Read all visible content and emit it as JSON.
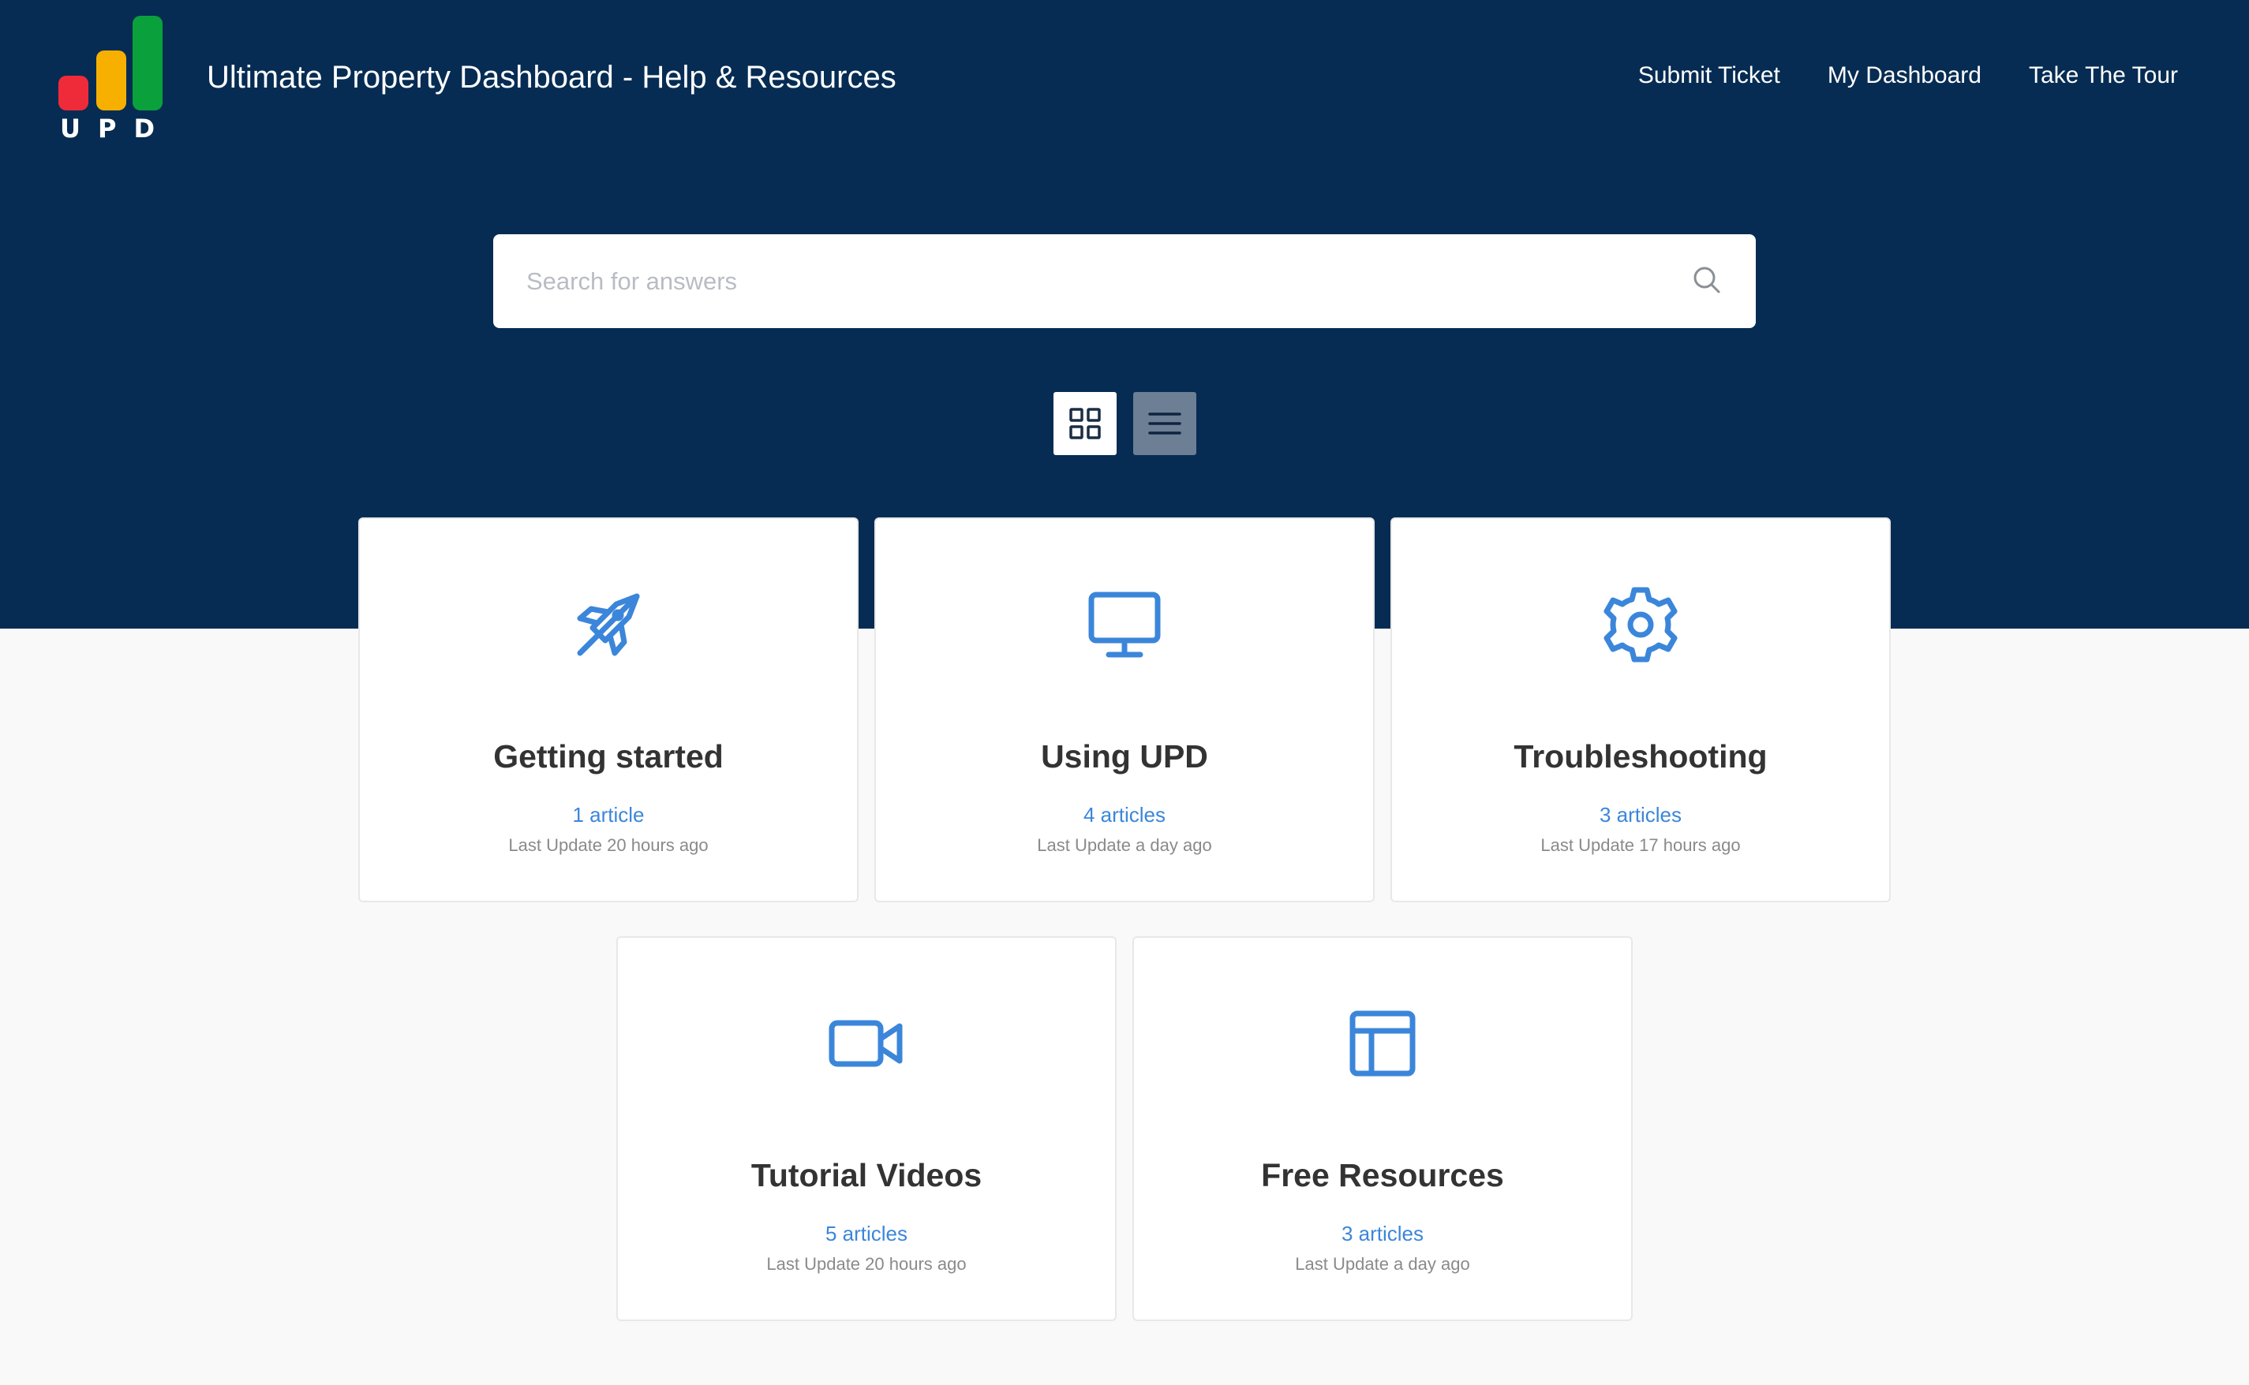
{
  "header": {
    "logo_text": "UPD",
    "site_title": "Ultimate Property Dashboard - Help & Resources",
    "nav": [
      "Submit Ticket",
      "My Dashboard",
      "Take The Tour"
    ]
  },
  "search": {
    "placeholder": "Search for answers"
  },
  "view_toggle": {
    "options": [
      "grid-icon",
      "list-icon"
    ],
    "active": "grid"
  },
  "colors": {
    "hero_bg": "#062c53",
    "accent": "#3b86da",
    "logo_red": "#ef2b3a",
    "logo_orange": "#f8b000",
    "logo_green": "#0aa13c"
  },
  "categories": [
    {
      "icon": "rocket-icon",
      "title": "Getting started",
      "count": "1 article",
      "updated": "Last Update 20 hours ago"
    },
    {
      "icon": "monitor-icon",
      "title": "Using UPD",
      "count": "4 articles",
      "updated": "Last Update a day ago"
    },
    {
      "icon": "gear-icon",
      "title": "Troubleshooting",
      "count": "3 articles",
      "updated": "Last Update 17 hours ago"
    },
    {
      "icon": "video-camera-icon",
      "title": "Tutorial Videos",
      "count": "5 articles",
      "updated": "Last Update 20 hours ago"
    },
    {
      "icon": "layout-icon",
      "title": "Free Resources",
      "count": "3 articles",
      "updated": "Last Update a day ago"
    }
  ]
}
